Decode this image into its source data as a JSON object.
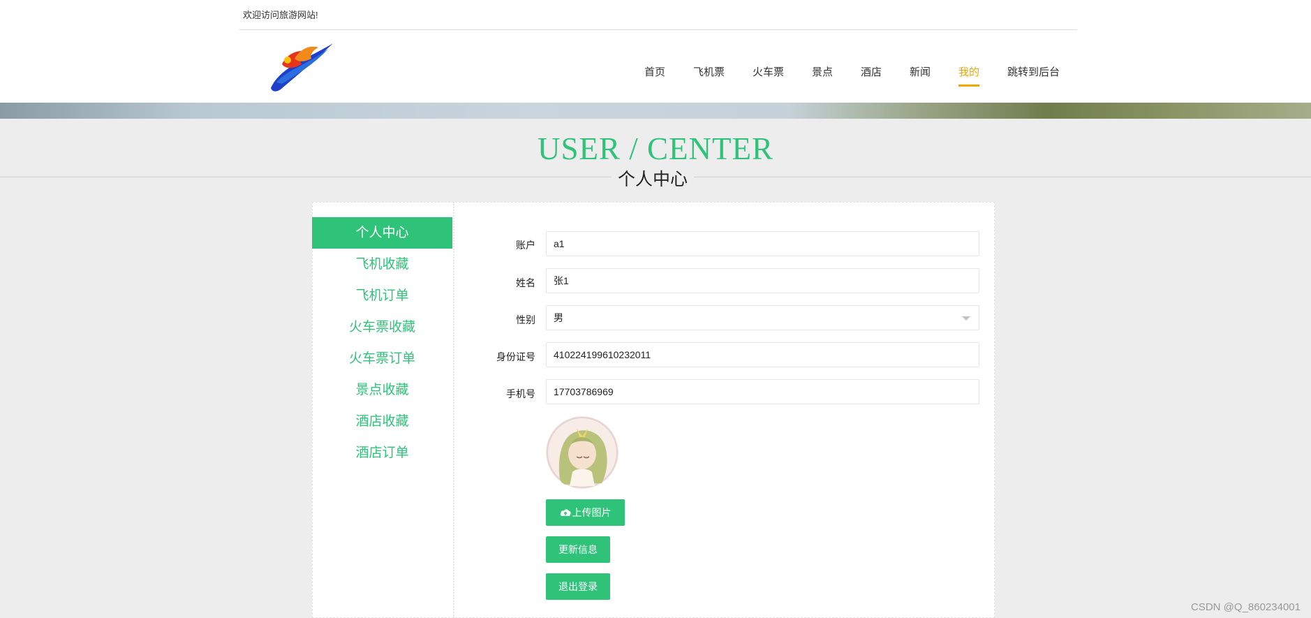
{
  "header": {
    "welcome": "欢迎访问旅游网站!",
    "nav": [
      {
        "label": "首页"
      },
      {
        "label": "飞机票"
      },
      {
        "label": "火车票"
      },
      {
        "label": "景点"
      },
      {
        "label": "酒店"
      },
      {
        "label": "新闻"
      },
      {
        "label": "我的"
      },
      {
        "label": "跳转到后台"
      }
    ],
    "active_nav": "我的"
  },
  "section": {
    "title_en": "USER / CENTER",
    "title_cn": "个人中心"
  },
  "sidebar": {
    "items": [
      {
        "label": "个人中心"
      },
      {
        "label": "飞机收藏"
      },
      {
        "label": "飞机订单"
      },
      {
        "label": "火车票收藏"
      },
      {
        "label": "火车票订单"
      },
      {
        "label": "景点收藏"
      },
      {
        "label": "酒店收藏"
      },
      {
        "label": "酒店订单"
      }
    ],
    "active": "个人中心"
  },
  "form": {
    "account": {
      "label": "账户",
      "value": "a1"
    },
    "name": {
      "label": "姓名",
      "value": "张1"
    },
    "gender": {
      "label": "性别",
      "value": "男"
    },
    "id_number": {
      "label": "身份证号",
      "value": "410224199610232011"
    },
    "phone": {
      "label": "手机号",
      "value": "17703786969"
    },
    "upload_label": "上传图片",
    "update_label": "更新信息",
    "logout_label": "退出登录"
  },
  "colors": {
    "accent": "#2fc37a",
    "nav_active": "#f0a800"
  },
  "icons": {
    "upload": "cloud-upload-icon"
  },
  "watermark": "CSDN @Q_860234001"
}
